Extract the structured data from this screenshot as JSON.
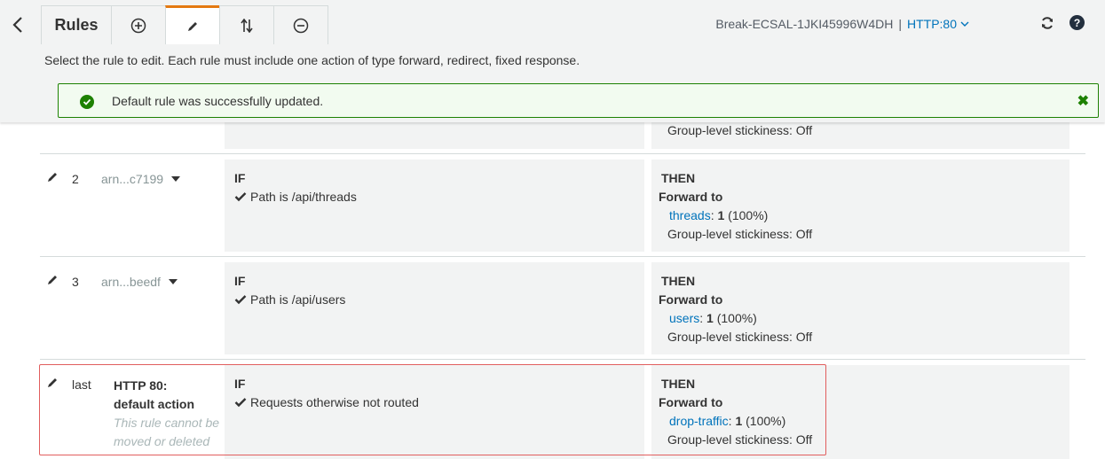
{
  "toolbar": {
    "title": "Rules",
    "load_balancer": "Break-ECSAL-1JKI45996W4DH",
    "separator": "|",
    "listener": "HTTP:80"
  },
  "instructions": "Select the rule to edit. Each rule must include one action of type forward, redirect, fixed response.",
  "flash": {
    "message": "Default rule was successfully updated.",
    "status_color": "#1d8102"
  },
  "rule0": {
    "stickiness": "Group-level stickiness: Off"
  },
  "rules": [
    {
      "priority": "2",
      "arn": "arn...c7199",
      "if_label": "IF",
      "condition": "Path is /api/threads",
      "then_label": "THEN",
      "forward_label": "Forward to",
      "target": "threads",
      "target_sep": ":",
      "weight": "1",
      "pct": "(100%)",
      "stickiness": "Group-level stickiness: Off"
    },
    {
      "priority": "3",
      "arn": "arn...beedf",
      "if_label": "IF",
      "condition": "Path is /api/users",
      "then_label": "THEN",
      "forward_label": "Forward to",
      "target": "users",
      "target_sep": ":",
      "weight": "1",
      "pct": "(100%)",
      "stickiness": "Group-level stickiness: Off"
    }
  ],
  "default_rule": {
    "priority": "last",
    "name_line1": "HTTP 80:",
    "name_line2": "default action",
    "note": "This rule cannot be moved or deleted",
    "if_label": "IF",
    "condition": "Requests otherwise not routed",
    "then_label": "THEN",
    "forward_label": "Forward to",
    "target": "drop-traffic",
    "target_sep": ":",
    "weight": "1",
    "pct": "(100%)",
    "stickiness": "Group-level stickiness: Off"
  },
  "colors": {
    "accent_tab": "#e47911",
    "link": "#0073bb",
    "highlight_border": "#e15e5e"
  },
  "icons": {
    "back": "chevron-left-icon",
    "add": "plus-circle-icon",
    "edit": "pencil-icon",
    "reorder": "reorder-arrows-icon",
    "delete": "minus-circle-icon",
    "refresh": "refresh-icon",
    "help": "help-icon"
  }
}
